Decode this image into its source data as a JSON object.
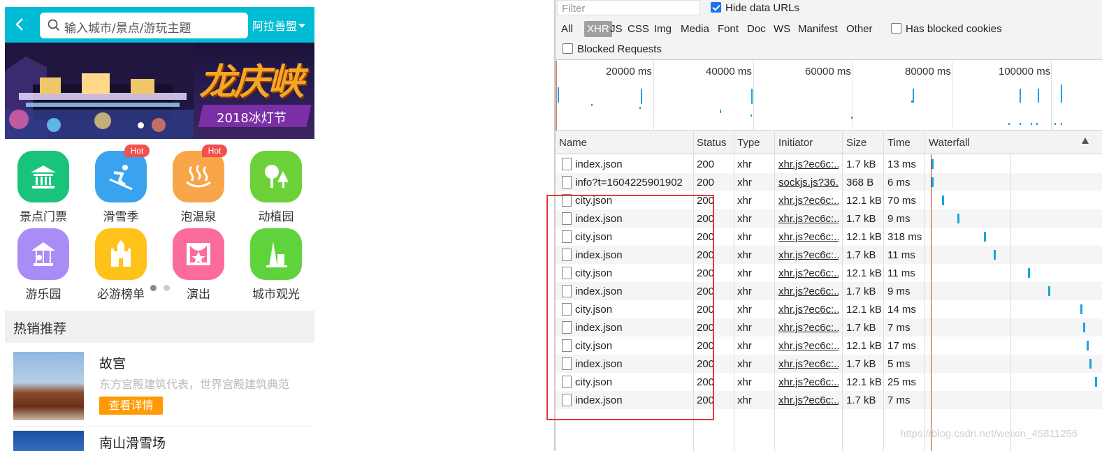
{
  "mobile": {
    "search_placeholder": "输入城市/景点/游玩主题",
    "city": "阿拉善盟",
    "banner": {
      "title": "龙庆峡",
      "subtitle": "2018冰灯节"
    },
    "categories": [
      {
        "label": "景点门票",
        "icon": "temple-icon",
        "color": "#19c47a",
        "hot": false
      },
      {
        "label": "滑雪季",
        "icon": "skier-icon",
        "color": "#3aa3f0",
        "hot": true
      },
      {
        "label": "泡温泉",
        "icon": "hot-spring-icon",
        "color": "#f9a64a",
        "hot": true
      },
      {
        "label": "动植园",
        "icon": "tree-icon",
        "color": "#6dd13a",
        "hot": false
      },
      {
        "label": "游乐园",
        "icon": "carousel-icon",
        "color": "#a98cf5",
        "hot": false
      },
      {
        "label": "必游榜单",
        "icon": "castle-icon",
        "color": "#ffc21a",
        "hot": false
      },
      {
        "label": "演出",
        "icon": "stage-icon",
        "color": "#fb6b9d",
        "hot": false
      },
      {
        "label": "城市观光",
        "icon": "tower-icon",
        "color": "#5fd33b",
        "hot": false
      }
    ],
    "hot_badge": "Hot",
    "section_title": "热销推荐",
    "items": [
      {
        "name": "故宫",
        "desc": "东方宫殿建筑代表，世界宫殿建筑典范",
        "button": "查看详情"
      },
      {
        "name": "南山滑雪场"
      }
    ]
  },
  "devtools": {
    "filter_placeholder": "Filter",
    "hide_data_urls": {
      "label": "Hide data URLs",
      "checked": true
    },
    "types": [
      "All",
      "XHR",
      "JS",
      "CSS",
      "Img",
      "Media",
      "Font",
      "Doc",
      "WS",
      "Manifest",
      "Other"
    ],
    "selected_type": "XHR",
    "has_blocked_cookies": {
      "label": "Has blocked cookies",
      "checked": false
    },
    "blocked_requests": {
      "label": "Blocked Requests",
      "checked": false
    },
    "timeline_labels": [
      "20000 ms",
      "40000 ms",
      "60000 ms",
      "80000 ms",
      "100000 ms"
    ],
    "columns": [
      "Name",
      "Status",
      "Type",
      "Initiator",
      "Size",
      "Time",
      "Waterfall"
    ],
    "rows": [
      {
        "name": "index.json",
        "status": "200",
        "type": "xhr",
        "initiator": "xhr.js?ec6c:...",
        "size": "1.7 kB",
        "time": "13 ms"
      },
      {
        "name": "info?t=1604225901902",
        "status": "200",
        "type": "xhr",
        "initiator": "sockjs.js?36...",
        "size": "368 B",
        "time": "6 ms"
      },
      {
        "name": "city.json",
        "status": "200",
        "type": "xhr",
        "initiator": "xhr.js?ec6c:...",
        "size": "12.1 kB",
        "time": "70 ms"
      },
      {
        "name": "index.json",
        "status": "200",
        "type": "xhr",
        "initiator": "xhr.js?ec6c:...",
        "size": "1.7 kB",
        "time": "9 ms"
      },
      {
        "name": "city.json",
        "status": "200",
        "type": "xhr",
        "initiator": "xhr.js?ec6c:...",
        "size": "12.1 kB",
        "time": "318 ms"
      },
      {
        "name": "index.json",
        "status": "200",
        "type": "xhr",
        "initiator": "xhr.js?ec6c:...",
        "size": "1.7 kB",
        "time": "11 ms"
      },
      {
        "name": "city.json",
        "status": "200",
        "type": "xhr",
        "initiator": "xhr.js?ec6c:...",
        "size": "12.1 kB",
        "time": "11 ms"
      },
      {
        "name": "index.json",
        "status": "200",
        "type": "xhr",
        "initiator": "xhr.js?ec6c:...",
        "size": "1.7 kB",
        "time": "9 ms"
      },
      {
        "name": "city.json",
        "status": "200",
        "type": "xhr",
        "initiator": "xhr.js?ec6c:...",
        "size": "12.1 kB",
        "time": "14 ms"
      },
      {
        "name": "index.json",
        "status": "200",
        "type": "xhr",
        "initiator": "xhr.js?ec6c:...",
        "size": "1.7 kB",
        "time": "7 ms"
      },
      {
        "name": "city.json",
        "status": "200",
        "type": "xhr",
        "initiator": "xhr.js?ec6c:...",
        "size": "12.1 kB",
        "time": "17 ms"
      },
      {
        "name": "index.json",
        "status": "200",
        "type": "xhr",
        "initiator": "xhr.js?ec6c:...",
        "size": "1.7 kB",
        "time": "5 ms"
      },
      {
        "name": "city.json",
        "status": "200",
        "type": "xhr",
        "initiator": "xhr.js?ec6c:...",
        "size": "12.1 kB",
        "time": "25 ms"
      },
      {
        "name": "index.json",
        "status": "200",
        "type": "xhr",
        "initiator": "xhr.js?ec6c:...",
        "size": "1.7 kB",
        "time": "7 ms"
      }
    ]
  },
  "watermark": "https://blog.csdn.net/weixin_45811256"
}
